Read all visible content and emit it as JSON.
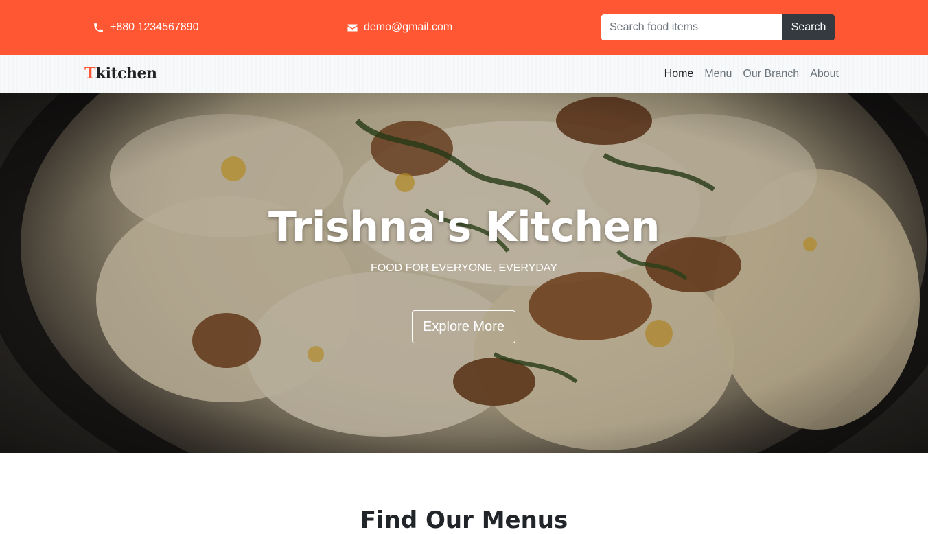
{
  "topbar": {
    "phone": "+880 1234567890",
    "email": "demo@gmail.com",
    "search_placeholder": "Search food items",
    "search_button": "Search",
    "bg_color": "#ff5733",
    "button_color": "#343a40"
  },
  "navbar": {
    "brand_first": "T",
    "brand_rest": "kitchen",
    "items": [
      {
        "label": "Home",
        "active": true
      },
      {
        "label": "Menu",
        "active": false
      },
      {
        "label": "Our Branch",
        "active": false
      },
      {
        "label": "About",
        "active": false
      }
    ]
  },
  "hero": {
    "title": "Trishna's Kitchen",
    "subtitle": "FOOD FOR EVERYONE, EVERYDAY",
    "button": "Explore More"
  },
  "section": {
    "title": "Find Our Menus"
  },
  "icons": {
    "phone": "phone-icon",
    "email": "envelope-icon"
  }
}
